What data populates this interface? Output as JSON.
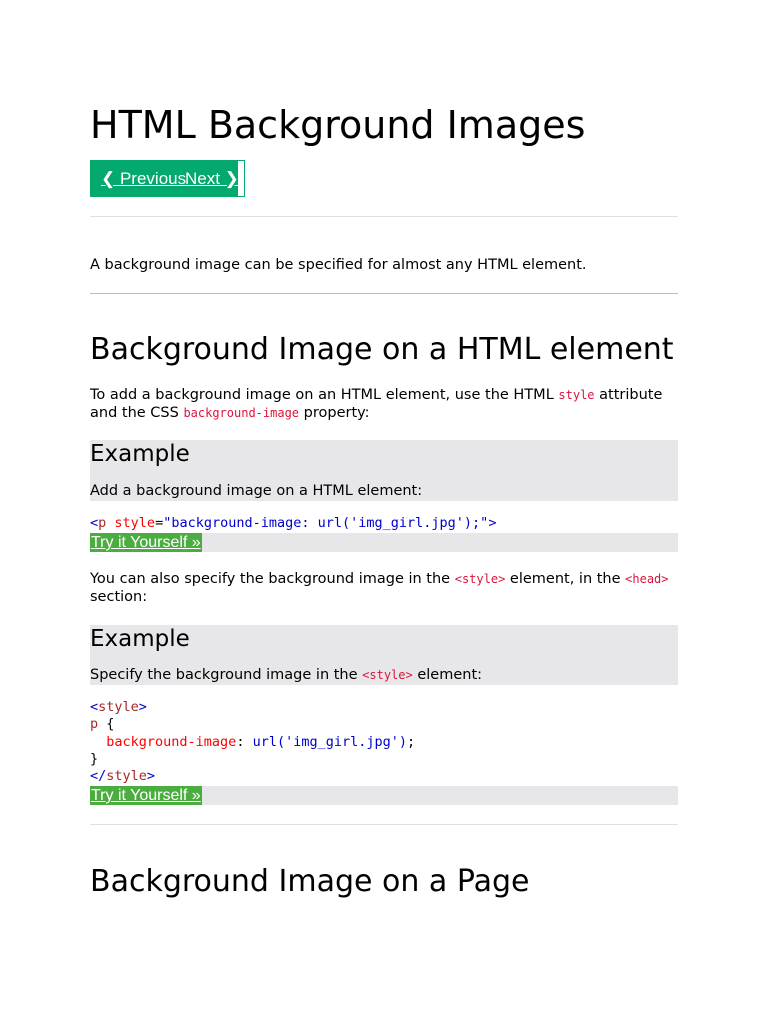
{
  "page": {
    "title": "HTML Background Images"
  },
  "nav": {
    "previous_label": "❮ Previous",
    "next_label": "Next ❯"
  },
  "intro": "A background image can be specified for almost any HTML element.",
  "section1": {
    "heading": "Background Image on a HTML element",
    "text_part1": "To add a background image on an HTML element, use the HTML ",
    "code1": "style",
    "text_part2": " attribute and the CSS ",
    "code2": "background-image",
    "text_part3": " property:",
    "example1": {
      "heading": "Example",
      "description": "Add a background image on a HTML element:",
      "code_open": "<",
      "code_tag": "p",
      "code_attr": " style",
      "code_eq": "=",
      "code_value": "\"background-image: url('img_girl.jpg');\"",
      "code_close": ">",
      "try_label": "Try it Yourself »"
    },
    "text2_part1": "You can also specify the background image in the ",
    "text2_code1": "<style>",
    "text2_part2": " element, in the ",
    "text2_code2": "<head>",
    "text2_part3": " section:",
    "example2": {
      "heading": "Example",
      "desc_part1": "Specify the background image in the ",
      "desc_code": "<style>",
      "desc_part2": " element:",
      "line1_open": "<",
      "line1_tag": "style",
      "line1_close": ">",
      "line2_sel": "p",
      "line2_brace": " {",
      "line3_indent": "  ",
      "line3_prop": "background-image",
      "line3_colon": ": ",
      "line3_val": "url('img_girl.jpg')",
      "line3_semi": ";",
      "line4_brace": "}",
      "line5_open": "</",
      "line5_tag": "style",
      "line5_close": ">",
      "try_label": "Try it Yourself »"
    }
  },
  "section2": {
    "heading": "Background Image on a Page"
  },
  "colors": {
    "accent_green": "#04aa6d",
    "try_button_green": "#4bac3f",
    "example_bg": "#e7e7e9",
    "inline_code_red": "#dc143c"
  }
}
